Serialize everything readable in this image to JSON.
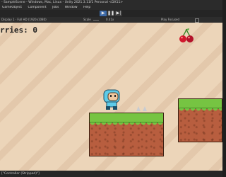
{
  "window": {
    "title": "- SampleScene - Windows, Mac, Linux - Unity 2021.3.11f1 Personal <DX11>"
  },
  "menu": {
    "items": [
      "GameObject",
      "Component",
      "Jobs",
      "Window",
      "Help"
    ]
  },
  "toolbar": {
    "play_icon": "▶",
    "pause_icon": "❚❚",
    "step_icon": "▶|"
  },
  "gamebar": {
    "display": "Display 1",
    "aspect": "Full HD (1920x1080)",
    "scale_label": "Scale",
    "scale_value": "0.41x",
    "maximize": "Play Focused"
  },
  "game": {
    "hud_text": "rries: 0"
  },
  "console": {
    "text": "[\"Controller (Stripped)\"]"
  },
  "colors": {
    "sky": "#ecd5b9",
    "grass": "#76c442",
    "dirt": "#b85e3f",
    "play_accent": "#3d6aa8",
    "player": "#5ecbe8"
  },
  "icons": [
    "play-icon",
    "pause-icon",
    "step-icon",
    "cherry-icon",
    "spike-icon"
  ]
}
